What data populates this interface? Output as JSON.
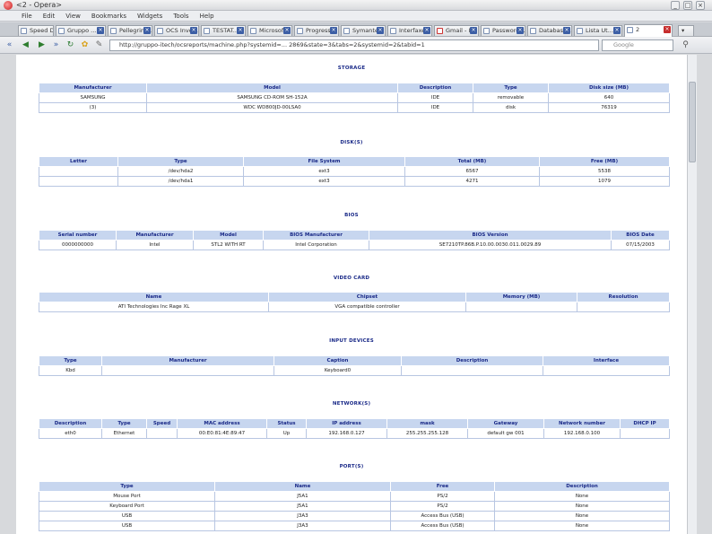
{
  "window": {
    "title": "<2 - Opera>"
  },
  "menu": [
    "File",
    "Edit",
    "View",
    "Bookmarks",
    "Widgets",
    "Tools",
    "Help"
  ],
  "tabs": [
    {
      "label": "Speed Dial"
    },
    {
      "label": "Gruppo ..."
    },
    {
      "label": "Pellegrino..."
    },
    {
      "label": "OCS Inve..."
    },
    {
      "label": "TESTAT..."
    },
    {
      "label": "Microsof..."
    },
    {
      "label": "Progress..."
    },
    {
      "label": "Symante..."
    },
    {
      "label": "Interfaxe..."
    },
    {
      "label": "Gmail - I..."
    },
    {
      "label": "Password..."
    },
    {
      "label": "Database..."
    },
    {
      "label": "Lista Ut..."
    },
    {
      "label": "2"
    }
  ],
  "address": {
    "url": "http://gruppo-itech/ocsreports/machine.php?systemid=... 2869&state=3&tabs=2&systemid=2&tabid=1",
    "search_placeholder": "Google"
  },
  "sections": {
    "storage": "STORAGE",
    "disks": "DISK(S)",
    "bios": "BIOS",
    "video": "VIDEO CARD",
    "input": "INPUT DEVICES",
    "network": "NETWORK(S)",
    "ports": "PORT(S)"
  },
  "storage": {
    "headers": [
      "Manufacturer",
      "Model",
      "Description",
      "Type",
      "Disk size (MB)"
    ],
    "rows": [
      [
        "SAMSUNG",
        "SAMSUNG CD-ROM SH-152A",
        "IDE",
        "removable",
        "640"
      ],
      [
        "(3)",
        "WDC WD800JD-00LSA0",
        "IDE",
        "disk",
        "76319"
      ]
    ]
  },
  "disks": {
    "headers": [
      "Letter",
      "Type",
      "File System",
      "Total (MB)",
      "Free (MB)"
    ],
    "rows": [
      [
        "",
        "/dev/hda2",
        "ext3",
        "6567",
        "5538"
      ],
      [
        "",
        "/dev/hda1",
        "ext3",
        "4271",
        "1079"
      ]
    ]
  },
  "bios": {
    "headers": [
      "Serial number",
      "Manufacturer",
      "Model",
      "BIOS Manufacturer",
      "BIOS Version",
      "BIOS Date"
    ],
    "rows": [
      [
        "0000000000",
        "Intel",
        "STL2 WITH RT",
        "Intel Corporation",
        "SE7210TP.86B.P.10.00.0030.011.0029.89",
        "07/15/2003"
      ]
    ]
  },
  "video": {
    "headers": [
      "Name",
      "Chipset",
      "Memory (MB)",
      "Resolution"
    ],
    "rows": [
      [
        "ATI Technologies Inc Rage XL",
        "VGA compatible controller",
        "",
        ""
      ]
    ]
  },
  "input": {
    "headers": [
      "Type",
      "Manufacturer",
      "Caption",
      "Description",
      "Interface"
    ],
    "rows": [
      [
        "Kbd",
        "",
        "Keyboard0",
        "",
        ""
      ]
    ]
  },
  "network": {
    "headers": [
      "Description",
      "Type",
      "Speed",
      "MAC address",
      "Status",
      "IP address",
      "mask",
      "Gateway",
      "Network number",
      "DHCP IP"
    ],
    "rows": [
      [
        "eth0",
        "Ethernet",
        "",
        "00:E0:81:4E:89:47",
        "Up",
        "192.168.0.127",
        "255.255.255.128",
        "default gw 001",
        "192.168.0.100",
        ""
      ]
    ]
  },
  "ports": {
    "headers": [
      "Type",
      "Name",
      "Free",
      "Description"
    ],
    "rows": [
      [
        "Mouse Port",
        "J5A1",
        "PS/2",
        "None"
      ],
      [
        "Keyboard Port",
        "J5A1",
        "PS/2",
        "None"
      ],
      [
        "USB",
        "J3A3",
        "Access Bus (USB)",
        "None"
      ],
      [
        "USB",
        "J3A3",
        "Access Bus (USB)",
        "None"
      ]
    ]
  }
}
